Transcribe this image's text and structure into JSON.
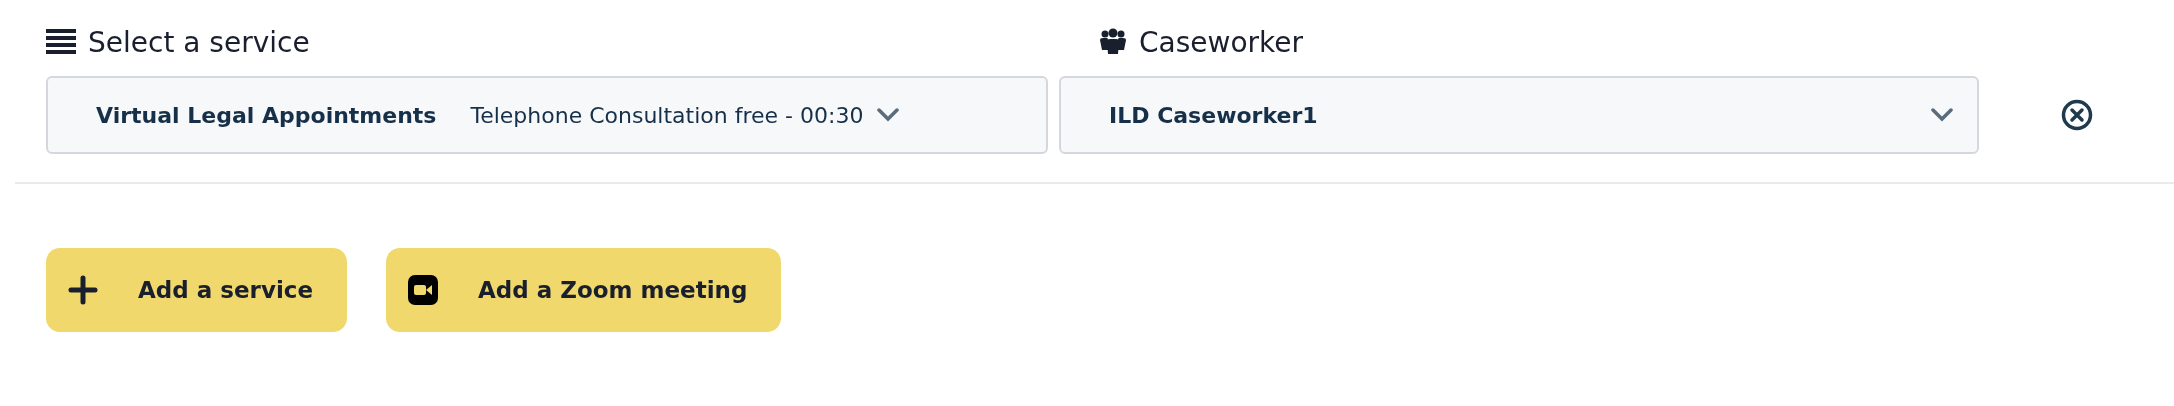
{
  "service": {
    "label": "Select a service",
    "group": "Virtual Legal Appointments",
    "value": "Telephone Consultation free - 00:30"
  },
  "caseworker": {
    "label": "Caseworker",
    "value": "ILD Caseworker1"
  },
  "buttons": [
    {
      "kind": "add",
      "label": "Add a service"
    },
    {
      "kind": "zoom",
      "label": "Add a Zoom meeting"
    }
  ]
}
